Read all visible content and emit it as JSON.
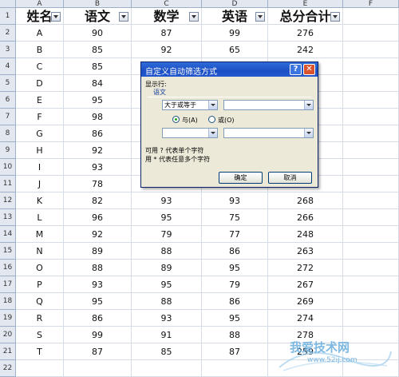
{
  "columns": [
    "A",
    "B",
    "C",
    "D",
    "E",
    "F"
  ],
  "rows": [
    "1",
    "2",
    "3",
    "4",
    "5",
    "6",
    "7",
    "8",
    "9",
    "10",
    "11",
    "12",
    "13",
    "14",
    "15",
    "16",
    "17",
    "18",
    "19",
    "20",
    "21",
    "22"
  ],
  "headers": [
    "姓名",
    "语文",
    "数学",
    "英语",
    "总分合计"
  ],
  "table": [
    [
      "A",
      "90",
      "87",
      "99",
      "276"
    ],
    [
      "B",
      "85",
      "92",
      "65",
      "242"
    ],
    [
      "C",
      "85",
      "",
      "",
      ""
    ],
    [
      "D",
      "84",
      "",
      "",
      ""
    ],
    [
      "E",
      "95",
      "",
      "",
      ""
    ],
    [
      "F",
      "98",
      "",
      "",
      ""
    ],
    [
      "G",
      "86",
      "",
      "",
      ""
    ],
    [
      "H",
      "92",
      "",
      "",
      ""
    ],
    [
      "I",
      "93",
      "",
      "",
      ""
    ],
    [
      "J",
      "78",
      "",
      "",
      ""
    ],
    [
      "K",
      "82",
      "93",
      "93",
      "268"
    ],
    [
      "L",
      "96",
      "95",
      "75",
      "266"
    ],
    [
      "M",
      "92",
      "79",
      "77",
      "248"
    ],
    [
      "N",
      "89",
      "88",
      "86",
      "263"
    ],
    [
      "O",
      "88",
      "89",
      "95",
      "272"
    ],
    [
      "P",
      "93",
      "95",
      "79",
      "267"
    ],
    [
      "Q",
      "95",
      "88",
      "86",
      "269"
    ],
    [
      "R",
      "86",
      "93",
      "95",
      "274"
    ],
    [
      "S",
      "99",
      "91",
      "88",
      "278"
    ],
    [
      "T",
      "87",
      "85",
      "87",
      "259"
    ]
  ],
  "dialog": {
    "title": "自定义自动筛选方式",
    "help_label": "?",
    "close_label": "✕",
    "show_rows_label": "显示行:",
    "field_name": "语文",
    "operator1": "大于或等于",
    "value1": "",
    "and_label": "与(A)",
    "or_label": "或(O)",
    "operator2": "",
    "value2": "",
    "hint1": "可用 ? 代表单个字符",
    "hint2": "用 * 代表任意多个字符",
    "ok_label": "确定",
    "cancel_label": "取消"
  },
  "watermark": {
    "text": "我爱技术网",
    "sub": "www.52ij.com"
  }
}
